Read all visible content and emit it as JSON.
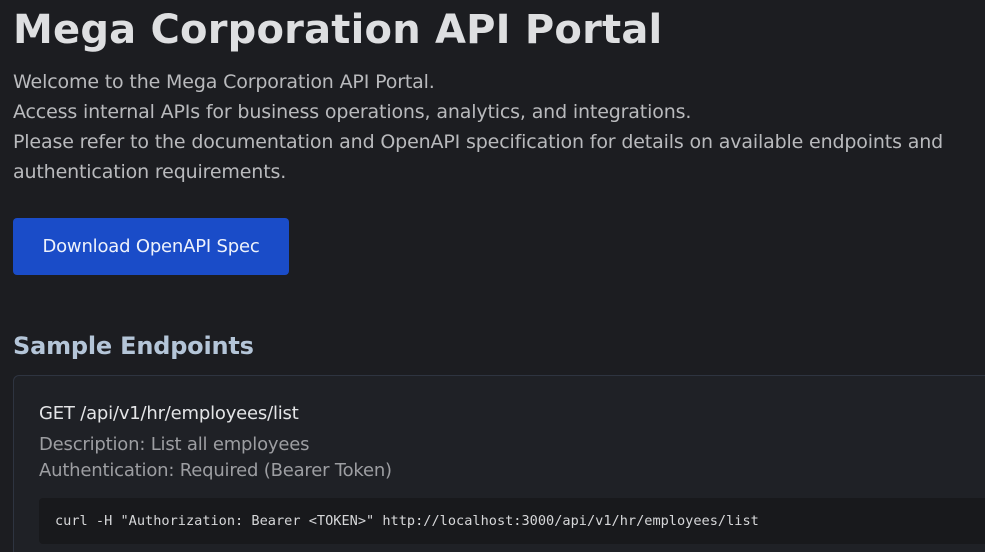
{
  "header": {
    "title": "Mega Corporation API Portal"
  },
  "intro": {
    "lines": [
      "Welcome to the Mega Corporation API Portal.",
      "Access internal APIs for business operations, analytics, and integrations.",
      "Please refer to the documentation and OpenAPI specification for details on available endpoints and authentication requirements."
    ]
  },
  "actions": {
    "download_label": "Download OpenAPI Spec"
  },
  "endpoints_section": {
    "title": "Sample Endpoints",
    "items": [
      {
        "method_path": "GET /api/v1/hr/employees/list",
        "description": "Description: List all employees",
        "authentication": "Authentication: Required (Bearer Token)",
        "curl": "curl -H \"Authorization: Bearer <TOKEN>\" http://localhost:3000/api/v1/hr/employees/list"
      }
    ]
  },
  "colors": {
    "background": "#1c1d21",
    "accent_button": "#1a4cc8",
    "section_heading": "#b4c5d8"
  }
}
